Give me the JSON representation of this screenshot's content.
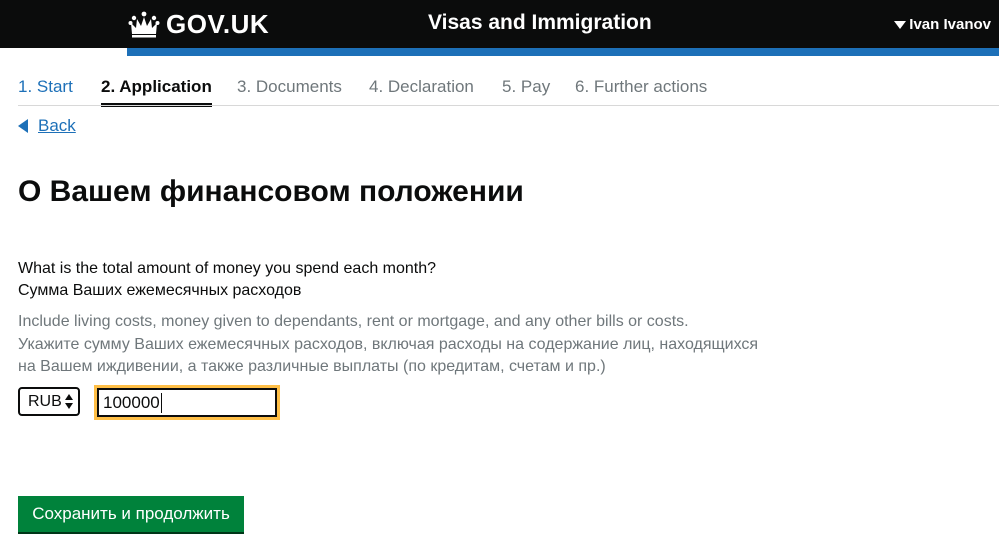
{
  "header": {
    "logo_text": "GOV.UK",
    "service_name": "Visas and Immigration",
    "user_name": "Ivan Ivanov",
    "colors": {
      "bar": "#0b0c0c",
      "accent": "#1d70b8"
    }
  },
  "steps": [
    {
      "label": "1. Start",
      "state": "done"
    },
    {
      "label": "2. Application",
      "state": "current"
    },
    {
      "label": "3. Documents",
      "state": "upcoming"
    },
    {
      "label": "4. Declaration",
      "state": "upcoming"
    },
    {
      "label": "5. Pay",
      "state": "upcoming"
    },
    {
      "label": "6. Further actions",
      "state": "upcoming"
    }
  ],
  "back_label": "Back",
  "page_title": "О Вашем финансовом положении",
  "question": {
    "label_en": "What is the total amount of money you spend each month?",
    "label_ru": "Сумма Ваших ежемесячных расходов",
    "hint_en": "Include living costs, money given to dependants, rent or mortgage, and any other bills or costs.",
    "hint_ru": "Укажите сумму Ваших ежемесячных расходов, включая расходы на содержание лиц, находящихся на Вашем иждивении, а также различные выплаты (по кредитам, счетам и пр.)"
  },
  "currency": {
    "selected": "RUB"
  },
  "amount": {
    "value": "100000"
  },
  "submit_label": "Сохранить и продолжить",
  "colors": {
    "link": "#1d70b8",
    "focus": "#ffbf47",
    "button": "#00823b",
    "hint": "#6f777b"
  }
}
